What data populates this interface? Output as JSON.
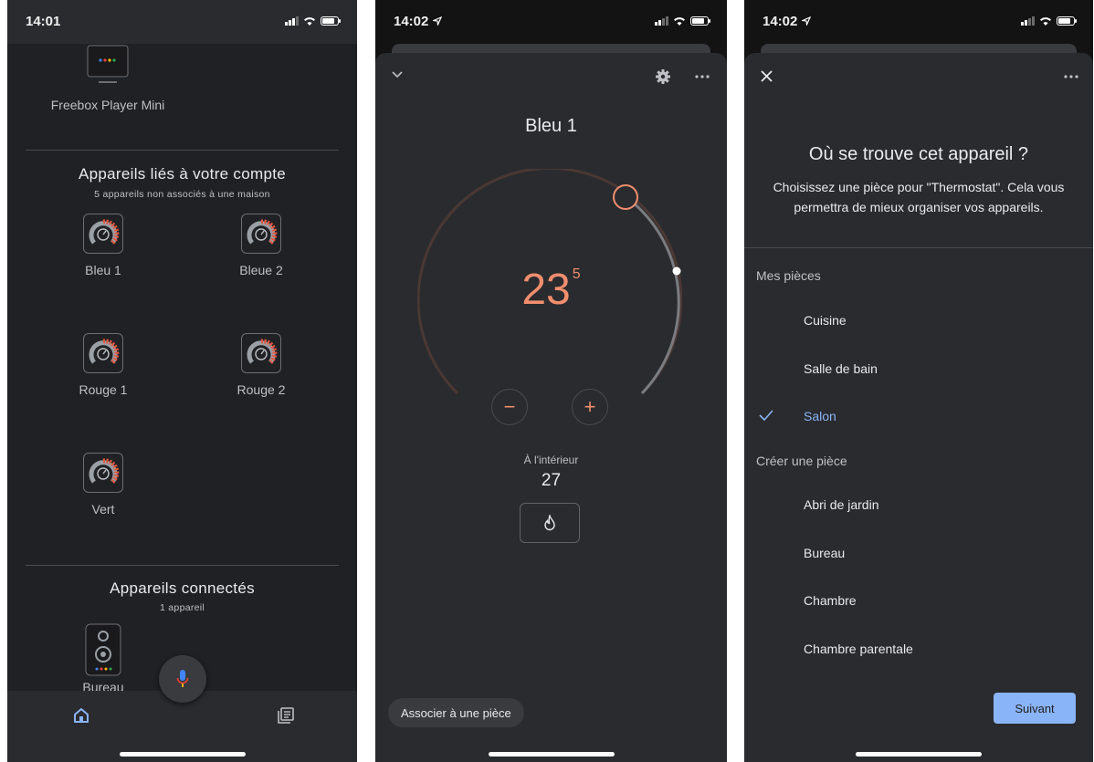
{
  "panel1": {
    "status_time": "14:01",
    "top_device": {
      "label": "Freebox Player Mini"
    },
    "linked_section": {
      "title": "Appareils liés à votre compte",
      "subtitle": "5 appareils non associés à une maison",
      "devices": [
        {
          "label": "Bleu 1",
          "icon": "thermostat-icon"
        },
        {
          "label": "Bleue 2",
          "icon": "thermostat-icon"
        },
        {
          "label": "Rouge 1",
          "icon": "thermostat-icon"
        },
        {
          "label": "Rouge 2",
          "icon": "thermostat-icon"
        },
        {
          "label": "Vert",
          "icon": "thermostat-icon"
        }
      ]
    },
    "connected_section": {
      "title": "Appareils connectés",
      "subtitle": "1 appareil",
      "devices": [
        {
          "label": "Bureau",
          "icon": "speaker-icon"
        }
      ]
    },
    "nav": {
      "home_icon": "home-icon",
      "feed_icon": "feed-icon",
      "mic_icon": "mic-icon"
    }
  },
  "panel2": {
    "status_time": "14:02",
    "device_name": "Bleu 1",
    "setpoint_main": "23",
    "setpoint_decimal": "5",
    "inside_label": "À l'intérieur",
    "inside_value": "27",
    "minus_label": "−",
    "plus_label": "+",
    "assign_room_label": "Associer à une pièce",
    "accent_color": "#f08e6e"
  },
  "panel3": {
    "status_time": "14:02",
    "title": "Où se trouve cet appareil ?",
    "description": "Choisissez une pièce pour \"Thermostat\". Cela vous permettra de mieux organiser vos appareils.",
    "my_rooms_label": "Mes pièces",
    "my_rooms": [
      "Cuisine",
      "Salle de bain",
      "Salon"
    ],
    "selected_room": "Salon",
    "create_room_label": "Créer une pièce",
    "create_rooms": [
      "Abri de jardin",
      "Bureau",
      "Chambre",
      "Chambre parentale"
    ],
    "next_label": "Suivant",
    "accent_color": "#8ab4f8"
  }
}
